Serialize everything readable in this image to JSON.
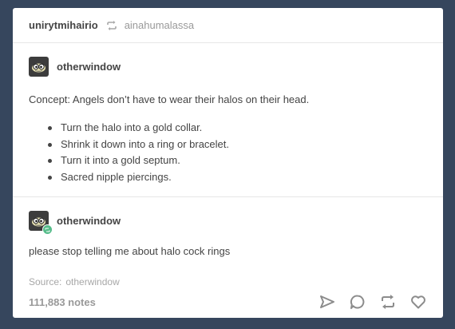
{
  "post": {
    "header": {
      "author": "unirytmihairio",
      "reblog_icon": "reblog-icon",
      "reblogged_from": "ainahumalassa"
    },
    "entries": [
      {
        "username": "otherwindow",
        "avatar_icon": "goggle-eyed-avatar",
        "text": "Concept: Angels don’t have to wear their halos on their head.",
        "bullets": [
          "Turn the halo into a gold collar.",
          "Shrink it down into a ring or bracelet.",
          "Turn it into a gold septum.",
          "Sacred nipple piercings."
        ]
      },
      {
        "username": "otherwindow",
        "avatar_icon": "goggle-eyed-avatar",
        "avatar_badge_icon": "reblog-badge-icon",
        "text": "please stop telling me about halo cock rings"
      }
    ],
    "source": {
      "label": "Source:",
      "value": "otherwindow"
    },
    "notes": "111,883 notes",
    "actions": [
      "share-icon",
      "reply-icon",
      "reblog-icon",
      "like-icon"
    ]
  },
  "colors": {
    "dashboard_background": "#36465d",
    "post_background": "#ffffff",
    "text": "#444444",
    "muted": "#999999",
    "badge_green": "#56bc8a"
  }
}
